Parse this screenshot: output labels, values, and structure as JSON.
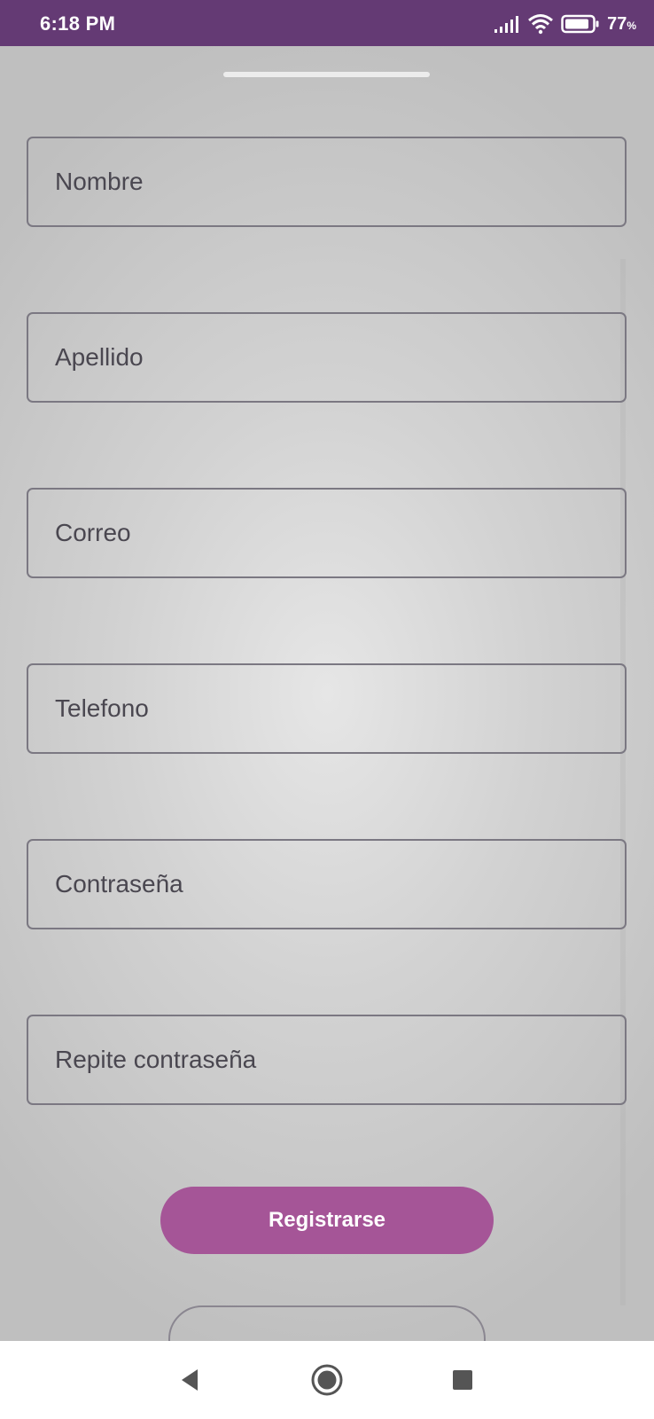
{
  "status_bar": {
    "time": "6:18 PM",
    "battery_percent": "77",
    "battery_unit": "%",
    "icons": [
      "signal-icon",
      "wifi-icon",
      "battery-icon"
    ]
  },
  "form": {
    "fields": [
      {
        "placeholder": "Nombre",
        "value": ""
      },
      {
        "placeholder": "Apellido",
        "value": ""
      },
      {
        "placeholder": "Correo",
        "value": ""
      },
      {
        "placeholder": "Telefono",
        "value": ""
      },
      {
        "placeholder": "Contraseña",
        "value": ""
      },
      {
        "placeholder": "Repite contraseña",
        "value": ""
      }
    ],
    "register_label": "Registrarse"
  },
  "colors": {
    "status_bar": "#643a74",
    "button": "#a55597",
    "field_border": "#7b7882",
    "field_text": "#4a4750"
  },
  "nav_bar": {
    "icons": [
      "back-icon",
      "home-icon",
      "recents-icon"
    ]
  }
}
